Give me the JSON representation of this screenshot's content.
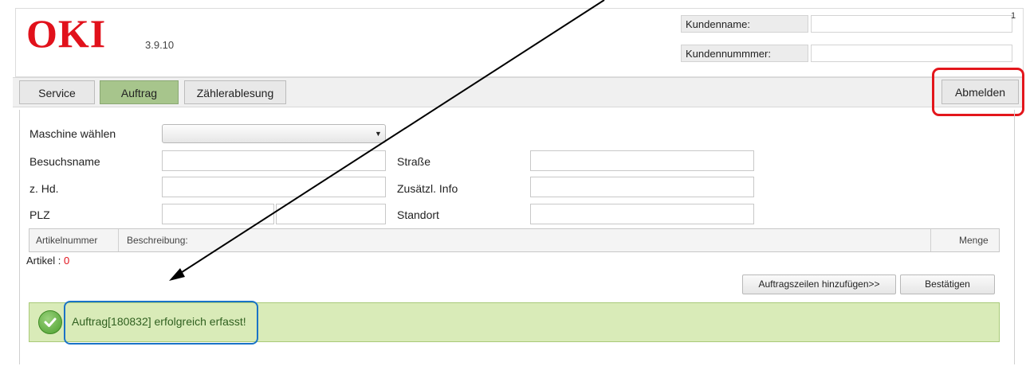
{
  "header": {
    "logo_text": "OKI",
    "version": "3.9.10",
    "customer_name_label": "Kundenname:",
    "customer_number_label": "Kundennummmer:",
    "customer_name_value": "",
    "customer_number_value": "",
    "corner_mark": "1"
  },
  "tabs": [
    {
      "label": "Service",
      "active": false
    },
    {
      "label": "Auftrag",
      "active": true
    },
    {
      "label": "Zählerablesung",
      "active": false
    }
  ],
  "logout_label": "Abmelden",
  "form": {
    "machine_label": "Maschine wählen",
    "machine_selected": "",
    "visit_name_label": "Besuchsname",
    "attention_label": "z. Hd.",
    "zip_label": "PLZ",
    "street_label": "Straße",
    "extra_info_label": "Zusätzl. Info",
    "location_label": "Standort"
  },
  "table": {
    "columns": [
      "Artikelnummer",
      "Beschreibung:",
      "Menge"
    ]
  },
  "articles": {
    "label": "Artikel : ",
    "count": "0"
  },
  "buttons": {
    "add_lines": "Auftragszeilen hinzufügen>>",
    "confirm": "Bestätigen"
  },
  "success_message": "Auftrag[180832] erfolgreich erfasst!",
  "colors": {
    "brand_red": "#e1111b",
    "active_tab": "#a7c58c",
    "success_bg": "#d9ebb8",
    "highlight_red": "#e3161c",
    "highlight_blue": "#1a73c7"
  }
}
